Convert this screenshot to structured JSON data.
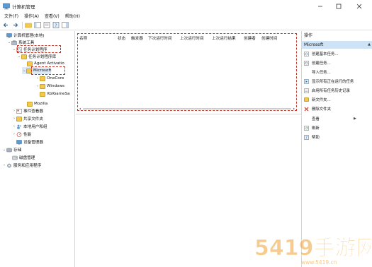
{
  "window": {
    "title": "计算机管理"
  },
  "menu": [
    "文件(F)",
    "操作(A)",
    "查看(V)",
    "帮助(H)"
  ],
  "tree": {
    "root": "计算机管理(本地)",
    "system_tools": "系统工具",
    "task_scheduler": "任务计划程序",
    "task_library": "任务计划程序库",
    "agent": "Agent Activatio",
    "microsoft": "Microsoft",
    "onecore": "OneCore",
    "windows": "Windows",
    "xbl": "XblGameSa",
    "mozilla": "Mozilla",
    "event_viewer": "事件查看器",
    "shared_folders": "共享文件夹",
    "local_users": "本地用户和组",
    "performance": "性能",
    "device_manager": "设备管理器",
    "storage": "存储",
    "disk_management": "磁盘管理",
    "services_apps": "服务和应用程序"
  },
  "columns": [
    "名称",
    "状态",
    "触发器",
    "下次运行时间",
    "上次运行时间",
    "上次运行结果",
    "创建者",
    "创建时间"
  ],
  "actions": {
    "header": "操作",
    "section": "Microsoft",
    "items": {
      "create_basic": "创建基本任务...",
      "create_task": "创建任务...",
      "import": "导入任务...",
      "show_running": "显示所有正在运行的任务",
      "enable_history": "启用所有任务历史记录",
      "new_folder": "新文件夹...",
      "delete_folder": "删除文件夹",
      "view": "查看",
      "refresh": "刷新",
      "help": "帮助"
    }
  },
  "watermark": {
    "text": "5419手游网",
    "url": "www.5419.cn"
  }
}
